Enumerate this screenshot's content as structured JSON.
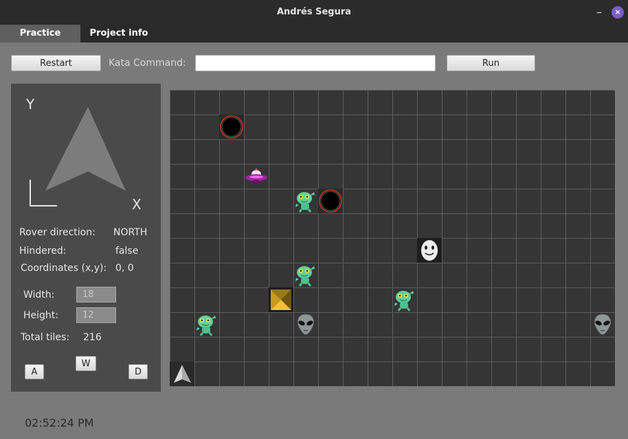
{
  "window": {
    "title": "Andrés Segura",
    "minimize": "–",
    "close": "×"
  },
  "tabs": [
    "Practice",
    "Project info"
  ],
  "toolbar": {
    "restart": "Restart",
    "kata_label": "Kata Command:",
    "kata_value": "",
    "run": "Run"
  },
  "panel": {
    "axis_y": "Y",
    "axis_x": "X",
    "direction_label": "Rover direction:",
    "direction_value": "NORTH",
    "hindered_label": "Hindered:",
    "hindered_value": "false",
    "coords_label": "Coordinates (x,y):",
    "coords_value": "0, 0",
    "width_label": "Width:",
    "width_value": "18",
    "height_label": "Height:",
    "height_value": "12",
    "total_label": "Total tiles:",
    "total_value": "216",
    "key_a": "A",
    "key_w": "W",
    "key_d": "D"
  },
  "grid": {
    "cols": 18,
    "rows": 12,
    "colors": {
      "background": "#353535",
      "lines": "#5e5e5e"
    },
    "objects": [
      {
        "type": "black-hole",
        "col": 2,
        "row": 1
      },
      {
        "type": "ufo",
        "col": 3,
        "row": 3
      },
      {
        "type": "green-alien",
        "col": 5,
        "row": 4
      },
      {
        "type": "black-hole",
        "col": 6,
        "row": 4
      },
      {
        "type": "moon-face",
        "col": 10,
        "row": 6
      },
      {
        "type": "green-alien",
        "col": 5,
        "row": 7
      },
      {
        "type": "pyramid",
        "col": 4,
        "row": 8
      },
      {
        "type": "green-alien",
        "col": 9,
        "row": 8
      },
      {
        "type": "green-alien",
        "col": 1,
        "row": 9
      },
      {
        "type": "grey-alien",
        "col": 5,
        "row": 9
      },
      {
        "type": "grey-alien",
        "col": 17,
        "row": 9
      },
      {
        "type": "rover",
        "col": 0,
        "row": 11
      }
    ]
  },
  "clock": "02:52:24 PM"
}
